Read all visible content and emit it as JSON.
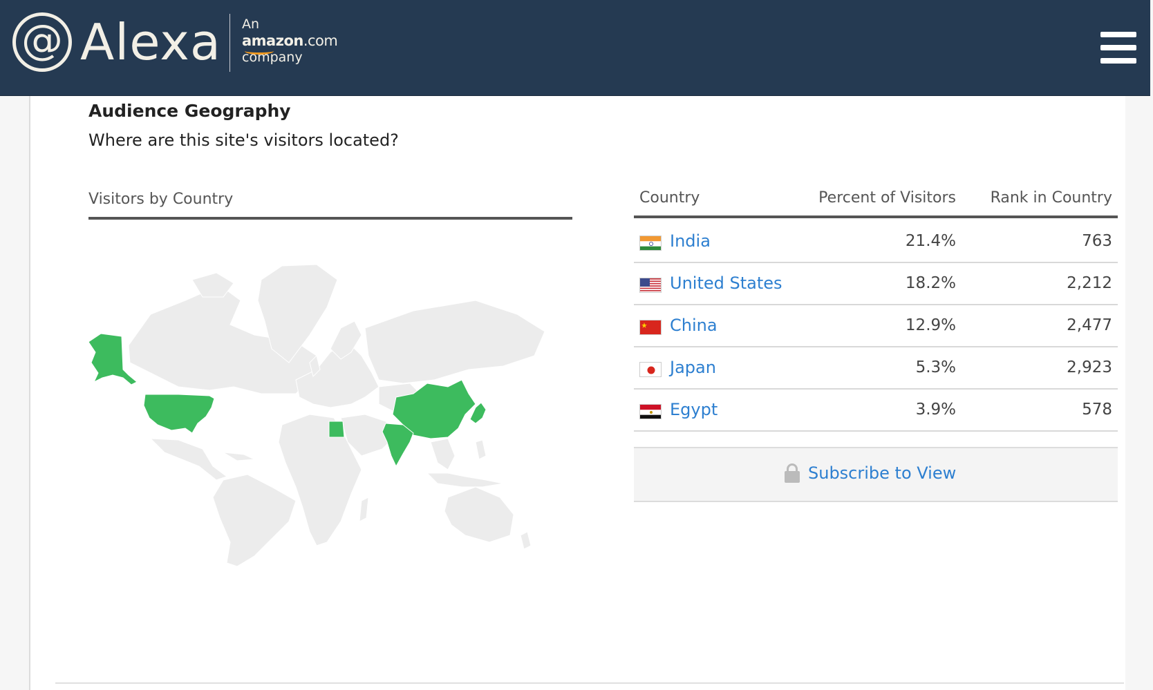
{
  "header": {
    "logo_mark": "@",
    "logo_text": "Alexa",
    "tagline_an": "An",
    "tagline_amazon": "amazon",
    "tagline_com": ".com",
    "tagline_company": "company"
  },
  "section": {
    "title": "Audience Geography",
    "subtitle": "Where are this site's visitors located?"
  },
  "map": {
    "title": "Visitors by Country",
    "highlight_color": "#3dbb5e",
    "land_color": "#ececec",
    "highlighted_countries": [
      "India",
      "United States",
      "China",
      "Japan",
      "Egypt"
    ]
  },
  "table": {
    "headers": {
      "country": "Country",
      "percent": "Percent of Visitors",
      "rank": "Rank in Country"
    },
    "rows": [
      {
        "country": "India",
        "percent": "21.4%",
        "rank": "763",
        "flag": "india-flag-icon"
      },
      {
        "country": "United States",
        "percent": "18.2%",
        "rank": "2,212",
        "flag": "us-flag-icon"
      },
      {
        "country": "China",
        "percent": "12.9%",
        "rank": "2,477",
        "flag": "china-flag-icon"
      },
      {
        "country": "Japan",
        "percent": "5.3%",
        "rank": "2,923",
        "flag": "japan-flag-icon"
      },
      {
        "country": "Egypt",
        "percent": "3.9%",
        "rank": "578",
        "flag": "egypt-flag-icon"
      }
    ],
    "subscribe_label": "Subscribe to View"
  },
  "colors": {
    "header_bg": "#253a52",
    "link": "#2d7fd0"
  }
}
